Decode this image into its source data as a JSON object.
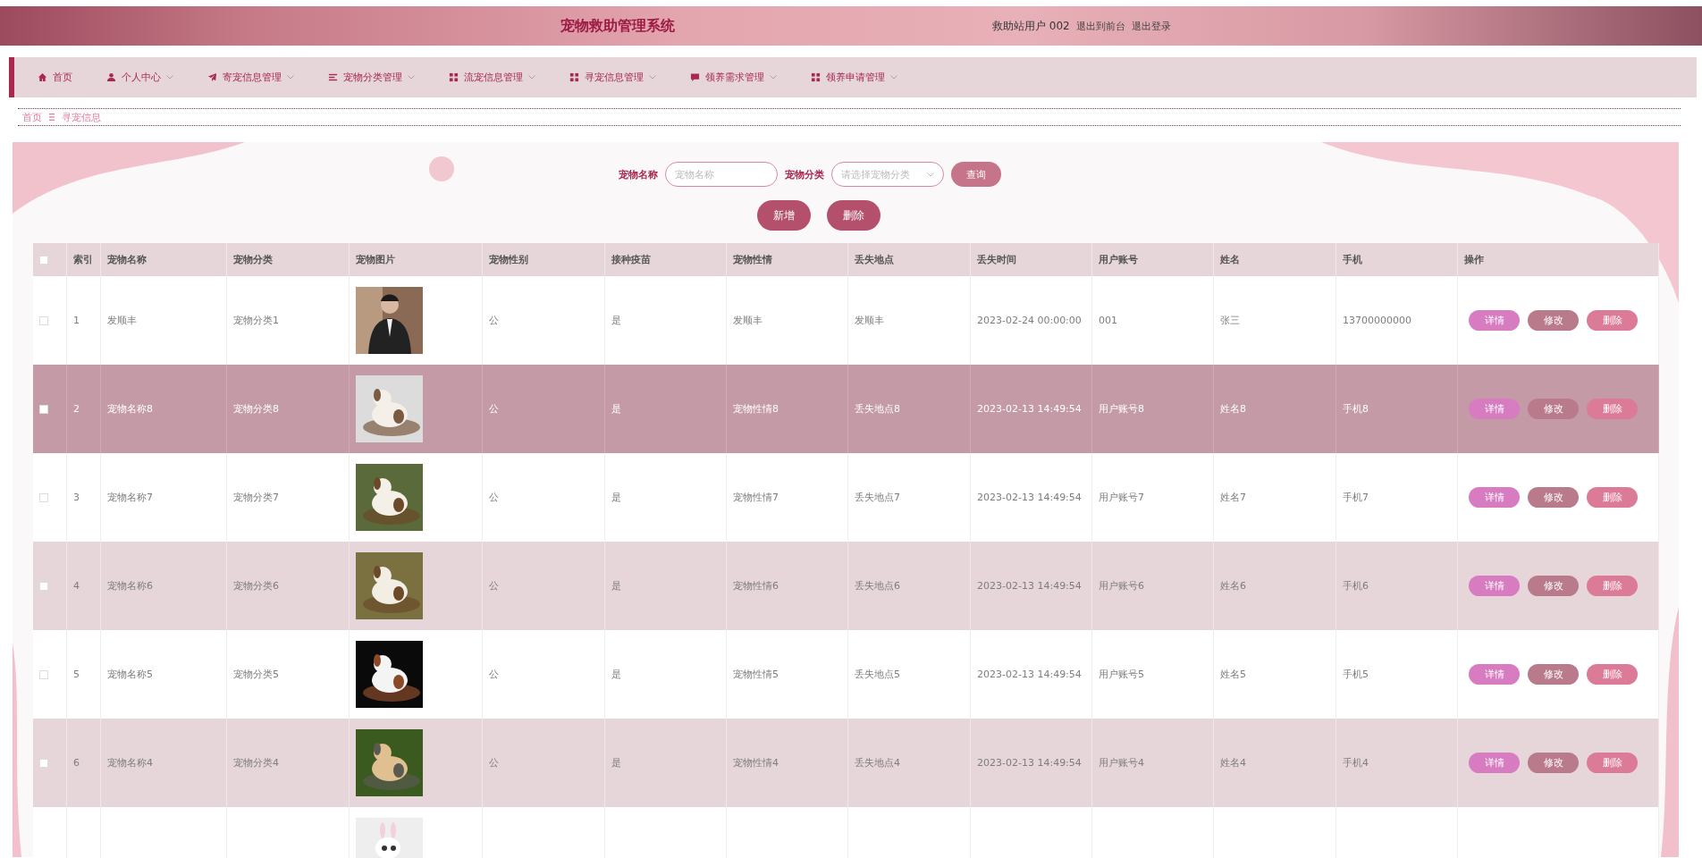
{
  "header": {
    "title": "宠物救助管理系统",
    "user": "救助站用户 002",
    "links": [
      "退出到前台",
      "退出登录"
    ]
  },
  "nav": [
    {
      "label": "首页",
      "dropdown": false
    },
    {
      "label": "个人中心",
      "dropdown": true
    },
    {
      "label": "寄宠信息管理",
      "dropdown": true
    },
    {
      "label": "宠物分类管理",
      "dropdown": true
    },
    {
      "label": "流宠信息管理",
      "dropdown": true
    },
    {
      "label": "寻宠信息管理",
      "dropdown": true
    },
    {
      "label": "领养需求管理",
      "dropdown": true
    },
    {
      "label": "领养申请管理",
      "dropdown": true
    }
  ],
  "breadcrumb": [
    "首页",
    "寻宠信息"
  ],
  "search": {
    "fields": [
      {
        "label": "宠物名称",
        "placeholder": "宠物名称",
        "kind": "text"
      },
      {
        "label": "宠物分类",
        "placeholder": "请选择宠物分类",
        "kind": "select"
      }
    ],
    "button": "查询"
  },
  "actions": [
    "新增",
    "删除"
  ],
  "table": {
    "columns": [
      "索引",
      "宠物名称",
      "宠物分类",
      "宠物图片",
      "宠物性别",
      "接种疫苗",
      "宠物性情",
      "丢失地点",
      "丢失时间",
      "用户账号",
      "姓名",
      "手机",
      "操作"
    ],
    "select_all_checked": false,
    "rows": [
      {
        "checked": false,
        "hovered": false,
        "cells": [
          "1",
          "发顺丰",
          "宠物分类1",
          {
            "kind": "picture"
          },
          "公",
          "是",
          "发顺丰",
          "发顺丰",
          "2023-02-24 00:00:00",
          "001",
          "张三",
          "13700000000"
        ],
        "buttons": [
          "详情",
          "修改",
          "删除"
        ]
      },
      {
        "checked": false,
        "hovered": true,
        "cells": [
          "2",
          "宠物名称8",
          "宠物分类8",
          {
            "kind": "picture"
          },
          "公",
          "是",
          "宠物性情8",
          "丢失地点8",
          "2023-02-13 14:49:54",
          "用户账号8",
          "姓名8",
          "手机8"
        ],
        "buttons": [
          "详情",
          "修改",
          "删除"
        ]
      },
      {
        "checked": false,
        "hovered": false,
        "cells": [
          "3",
          "宠物名称7",
          "宠物分类7",
          {
            "kind": "picture"
          },
          "公",
          "是",
          "宠物性情7",
          "丢失地点7",
          "2023-02-13 14:49:54",
          "用户账号7",
          "姓名7",
          "手机7"
        ],
        "buttons": [
          "详情",
          "修改",
          "删除"
        ]
      },
      {
        "checked": false,
        "hovered": false,
        "cells": [
          "4",
          "宠物名称6",
          "宠物分类6",
          {
            "kind": "picture"
          },
          "公",
          "是",
          "宠物性情6",
          "丢失地点6",
          "2023-02-13 14:49:54",
          "用户账号6",
          "姓名6",
          "手机6"
        ],
        "buttons": [
          "详情",
          "修改",
          "删除"
        ]
      },
      {
        "checked": false,
        "hovered": false,
        "cells": [
          "5",
          "宠物名称5",
          "宠物分类5",
          {
            "kind": "picture"
          },
          "公",
          "是",
          "宠物性情5",
          "丢失地点5",
          "2023-02-13 14:49:54",
          "用户账号5",
          "姓名5",
          "手机5"
        ],
        "buttons": [
          "详情",
          "修改",
          "删除"
        ]
      },
      {
        "checked": false,
        "hovered": false,
        "cells": [
          "6",
          "宠物名称4",
          "宠物分类4",
          {
            "kind": "picture"
          },
          "公",
          "是",
          "宠物性情4",
          "丢失地点4",
          "2023-02-13 14:49:54",
          "用户账号4",
          "姓名4",
          "手机4"
        ],
        "buttons": [
          "详情",
          "修改",
          "删除"
        ]
      }
    ],
    "partial_row": {
      "kind": "picture"
    }
  }
}
